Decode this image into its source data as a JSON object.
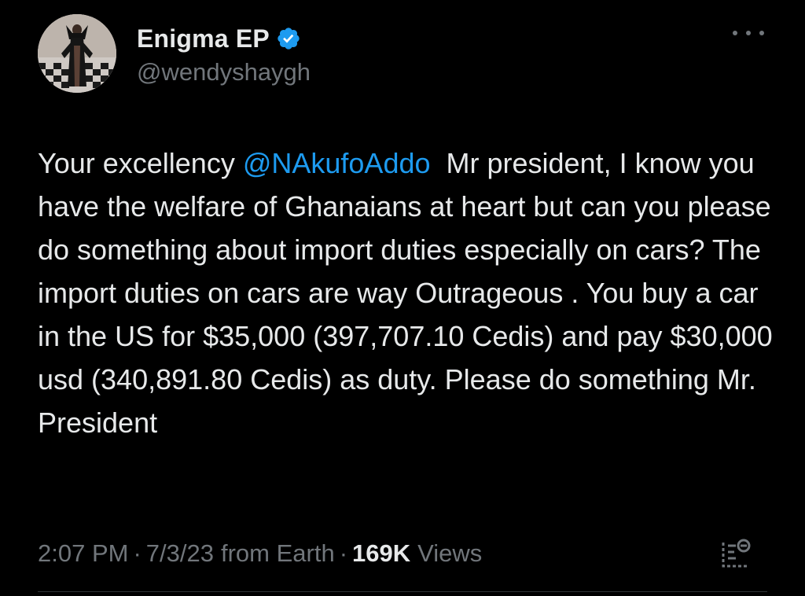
{
  "user": {
    "display_name": "Enigma EP",
    "handle": "@wendyshaygh",
    "verified": true,
    "avatar_icon": "profile-photo"
  },
  "tweet": {
    "text_before": "Your excellency ",
    "mention": "@NAkufoAddo",
    "text_after": "  Mr president, I know you have the welfare of Ghanaians at heart but can you please do something about import duties especially on cars? The import duties on cars are way Outrageous . You buy a car in the US for $35,000 (397,707.10 Cedis) and pay $30,000 usd (340,891.80 Cedis) as duty. Please do something Mr. President"
  },
  "meta": {
    "time": "2:07 PM",
    "separator": "·",
    "date": "7/3/23",
    "source": "from Earth",
    "views_count": "169K",
    "views_label": "Views"
  },
  "icons": {
    "more": "more-horizontal-icon",
    "verified": "verified-badge-icon",
    "analytics": "analytics-icon"
  },
  "colors": {
    "background": "#000000",
    "text": "#e7e9ea",
    "secondary": "#71767b",
    "accent": "#1d9bf0"
  }
}
